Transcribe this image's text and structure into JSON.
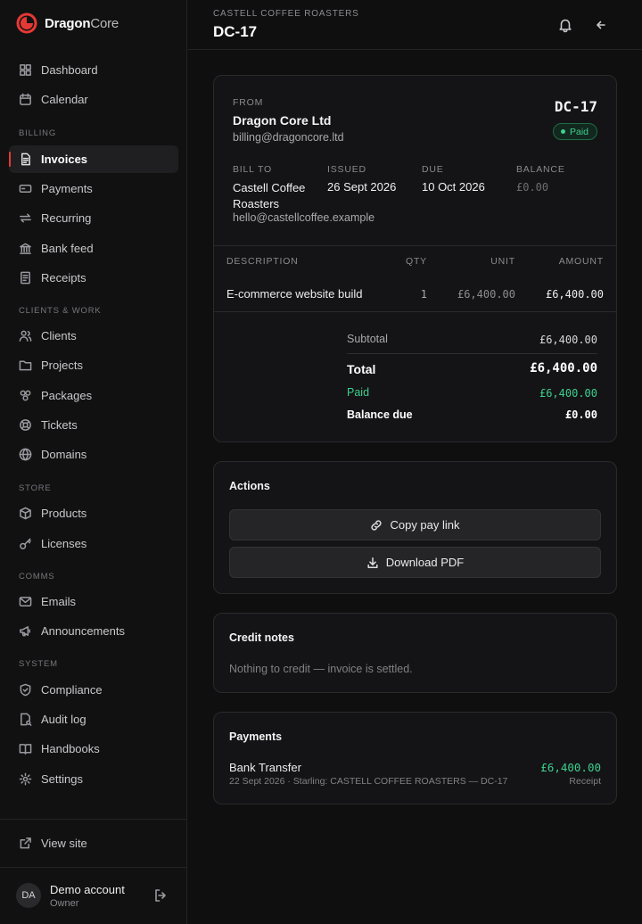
{
  "brand": {
    "name_bold": "Dragon",
    "name_light": "Core"
  },
  "sidebar": {
    "top_items": [
      {
        "label": "Dashboard",
        "icon": "dashboard-icon"
      },
      {
        "label": "Calendar",
        "icon": "calendar-icon"
      }
    ],
    "sections": [
      {
        "title": "BILLING",
        "items": [
          {
            "label": "Invoices",
            "icon": "invoice-icon",
            "active": true
          },
          {
            "label": "Payments",
            "icon": "payments-icon"
          },
          {
            "label": "Recurring",
            "icon": "recurring-icon"
          },
          {
            "label": "Bank feed",
            "icon": "bank-icon"
          },
          {
            "label": "Receipts",
            "icon": "receipt-icon"
          }
        ]
      },
      {
        "title": "CLIENTS & WORK",
        "items": [
          {
            "label": "Clients",
            "icon": "users-icon"
          },
          {
            "label": "Projects",
            "icon": "folder-icon"
          },
          {
            "label": "Packages",
            "icon": "packages-icon"
          },
          {
            "label": "Tickets",
            "icon": "lifebuoy-icon"
          },
          {
            "label": "Domains",
            "icon": "globe-icon"
          }
        ]
      },
      {
        "title": "STORE",
        "items": [
          {
            "label": "Products",
            "icon": "box-icon"
          },
          {
            "label": "Licenses",
            "icon": "key-icon"
          }
        ]
      },
      {
        "title": "COMMS",
        "items": [
          {
            "label": "Emails",
            "icon": "mail-icon"
          },
          {
            "label": "Announcements",
            "icon": "megaphone-icon"
          }
        ]
      },
      {
        "title": "SYSTEM",
        "items": [
          {
            "label": "Compliance",
            "icon": "shield-icon"
          },
          {
            "label": "Audit log",
            "icon": "audit-icon"
          },
          {
            "label": "Handbooks",
            "icon": "book-icon"
          },
          {
            "label": "Settings",
            "icon": "gear-icon"
          }
        ]
      }
    ],
    "view_site": "View site",
    "account": {
      "initials": "DA",
      "name": "Demo account",
      "role": "Owner"
    }
  },
  "header": {
    "subtitle": "CASTELL COFFEE ROASTERS",
    "title": "DC-17",
    "icons": [
      "bell-icon",
      "back-arrow-icon"
    ]
  },
  "invoice": {
    "from_label": "FROM",
    "from_name": "Dragon Core Ltd",
    "from_email": "billing@dragoncore.ltd",
    "number": "DC-17",
    "status": "Paid",
    "bill_to_label": "BILL TO",
    "bill_to_name_line1": "Castell Coffee",
    "bill_to_name_line2": "Roasters",
    "bill_to_email": "hello@castellcoffee.example",
    "issued_label": "ISSUED",
    "issued": "26 Sept 2026",
    "due_label": "DUE",
    "due": "10 Oct 2026",
    "balance_label": "BALANCE",
    "balance": "£0.00",
    "columns": {
      "description": "DESCRIPTION",
      "qty": "QTY",
      "unit": "UNIT",
      "amount": "AMOUNT"
    },
    "line_items": [
      {
        "description": "E-commerce website build",
        "qty": "1",
        "unit": "£6,400.00",
        "amount": "£6,400.00"
      }
    ],
    "subtotal_label": "Subtotal",
    "subtotal": "£6,400.00",
    "total_label": "Total",
    "total": "£6,400.00",
    "paid_label": "Paid",
    "paid": "£6,400.00",
    "balance_due_label": "Balance due",
    "balance_due": "£0.00"
  },
  "actions": {
    "title": "Actions",
    "copy_link": "Copy pay link",
    "download_pdf": "Download PDF"
  },
  "credit_notes": {
    "title": "Credit notes",
    "empty": "Nothing to credit — invoice is settled."
  },
  "payments": {
    "title": "Payments",
    "items": [
      {
        "method": "Bank Transfer",
        "detail": "22 Sept 2026 · Starling: CASTELL COFFEE ROASTERS — DC-17",
        "amount": "£6,400.00",
        "link": "Receipt"
      }
    ]
  },
  "colors": {
    "accent": "#e53935",
    "success": "#3ecf8e",
    "background": "#0f0f10"
  }
}
